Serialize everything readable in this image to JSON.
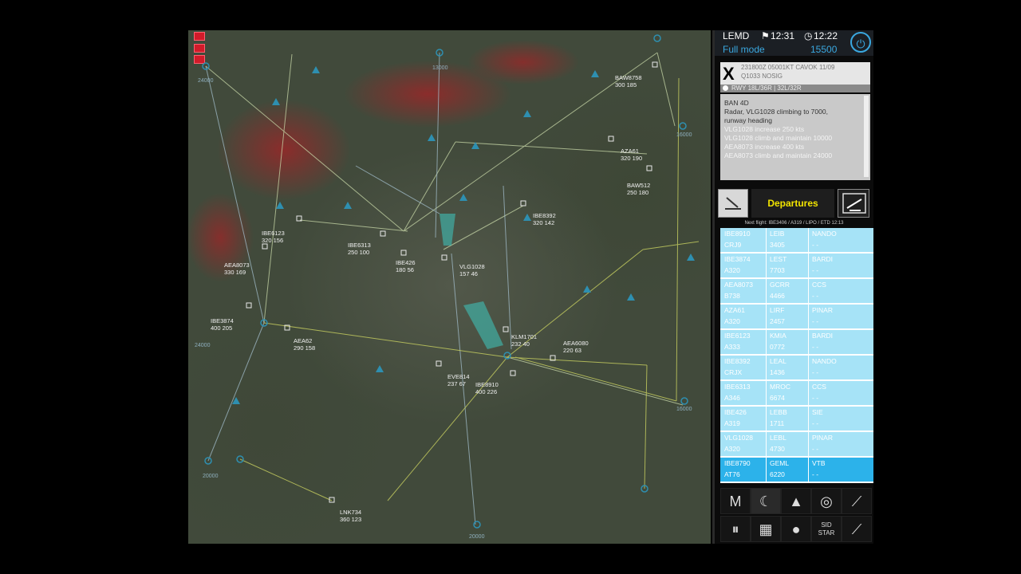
{
  "header": {
    "airport": "LEMD",
    "time_a": "12:31",
    "time_b": "12:22",
    "mode": "Full mode",
    "alt": "15500"
  },
  "metar": {
    "line1": "231800Z 05001KT CAVOK 11/09",
    "line2": "Q1033 NOSIG",
    "rwy": "RWY 18L/36R | 32L/32R"
  },
  "log": {
    "lines": [
      "BAN 4D",
      "Radar, VLG1028 climbing to 7000,",
      "runway heading",
      "VLG1028 increase 250 kts",
      "VLG1028 climb and maintain 10000",
      "AEA8073 increase 400 kts",
      "AEA8073 climb and maintain 24000"
    ]
  },
  "tabs": {
    "main": "Departures"
  },
  "next_flight": "Next flight: IBE3406 / A319 / LIPO / ETD 12:13",
  "strips": [
    {
      "cs": "IBE8910",
      "type": "CRJ9",
      "dest": "LEIB",
      "sq": "3405",
      "fix": "NANDO",
      "sub": "- -"
    },
    {
      "cs": "IBE3874",
      "type": "A320",
      "dest": "LEST",
      "sq": "7703",
      "fix": "BARDI",
      "sub": "- -"
    },
    {
      "cs": "AEA8073",
      "type": "B738",
      "dest": "GCRR",
      "sq": "4466",
      "fix": "CCS",
      "sub": "- -"
    },
    {
      "cs": "AZA61",
      "type": "A320",
      "dest": "LIRF",
      "sq": "2457",
      "fix": "PINAR",
      "sub": "- -"
    },
    {
      "cs": "IBE6123",
      "type": "A333",
      "dest": "KMIA",
      "sq": "0772",
      "fix": "BARDI",
      "sub": "- -"
    },
    {
      "cs": "IBE8392",
      "type": "CRJX",
      "dest": "LEAL",
      "sq": "1436",
      "fix": "NANDO",
      "sub": "- -"
    },
    {
      "cs": "IBE6313",
      "type": "A346",
      "dest": "MROC",
      "sq": "6674",
      "fix": "CCS",
      "sub": "- -"
    },
    {
      "cs": "IBE426",
      "type": "A319",
      "dest": "LEBB",
      "sq": "1711",
      "fix": "SIE",
      "sub": "- -"
    },
    {
      "cs": "VLG1028",
      "type": "A320",
      "dest": "LEBL",
      "sq": "4730",
      "fix": "PINAR",
      "sub": "- -"
    },
    {
      "cs": "IBE8790",
      "type": "AT76",
      "dest": "GEML",
      "sq": "6220",
      "fix": "VTB",
      "sub": "- -"
    }
  ],
  "tools": {
    "m_label": "M",
    "sid": "SID",
    "star": "STAR"
  },
  "aircraft": [
    {
      "id": "BAW8758",
      "alt": "300 185"
    },
    {
      "id": "AZA61",
      "alt": "320 190"
    },
    {
      "id": "BAW512",
      "alt": "250 180"
    },
    {
      "id": "IBE8392",
      "alt": "320 142"
    },
    {
      "id": "IBE6123",
      "alt": "320 156"
    },
    {
      "id": "IBE6313",
      "alt": "250 100"
    },
    {
      "id": "AEA8073",
      "alt": "330 169"
    },
    {
      "id": "IBE426",
      "alt": "180 56"
    },
    {
      "id": "VLG1028",
      "alt": "157 46"
    },
    {
      "id": "IBE3874",
      "alt": "400 205"
    },
    {
      "id": "AEA62",
      "alt": "290 158"
    },
    {
      "id": "KLM1701",
      "alt": "232 40"
    },
    {
      "id": "AEA6080",
      "alt": "220 63"
    },
    {
      "id": "EVE814",
      "alt": "237 67"
    },
    {
      "id": "IBE8910",
      "alt": "400 226"
    },
    {
      "id": "LNK734",
      "alt": "360 123"
    }
  ],
  "fixes": [
    {
      "name": "13000"
    },
    {
      "name": "24000"
    },
    {
      "name": "16000"
    },
    {
      "name": "24000"
    },
    {
      "name": "20000"
    },
    {
      "name": "16000"
    },
    {
      "name": "20000"
    }
  ]
}
